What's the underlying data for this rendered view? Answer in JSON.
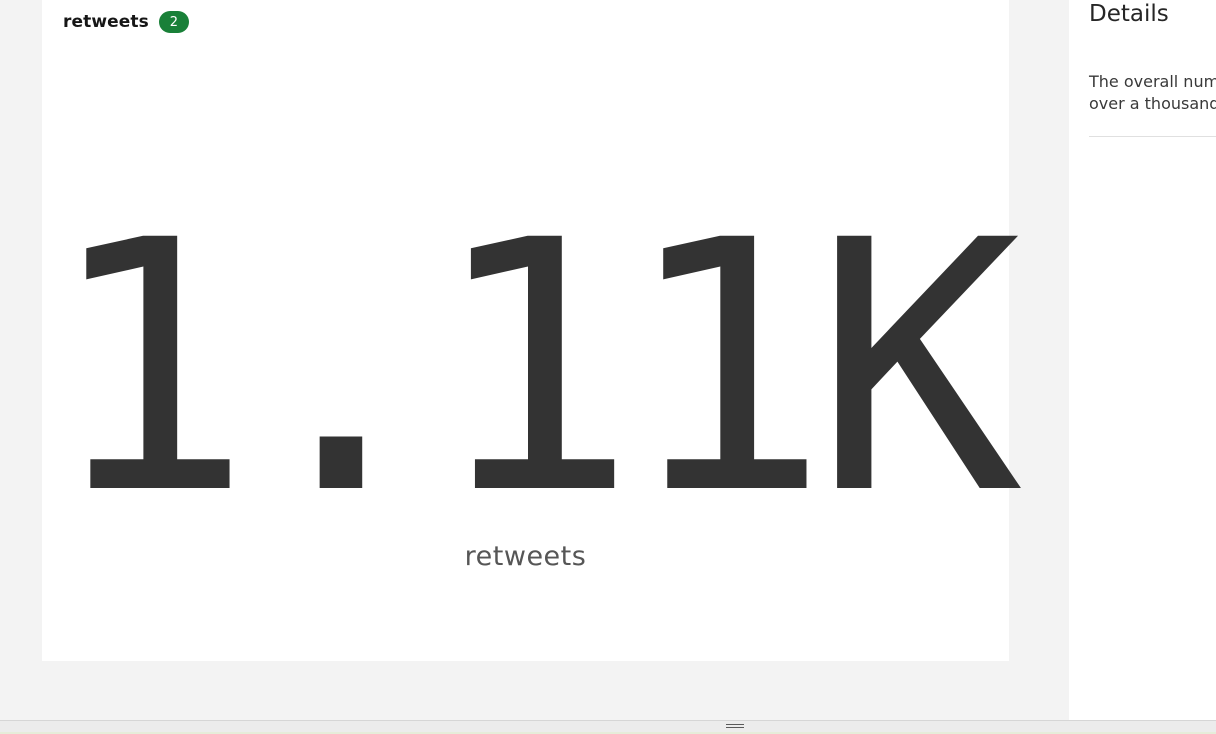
{
  "card": {
    "title": "retweets",
    "badge_count": "2",
    "kpi_value": "1.11K",
    "kpi_label": "retweets"
  },
  "details_panel": {
    "title": "Details",
    "description_lines": [
      "The overall num",
      "over a thousand"
    ]
  },
  "colors": {
    "badge": "#198038",
    "kpi_text": "#333333",
    "page_background": "#f3f3f3"
  }
}
